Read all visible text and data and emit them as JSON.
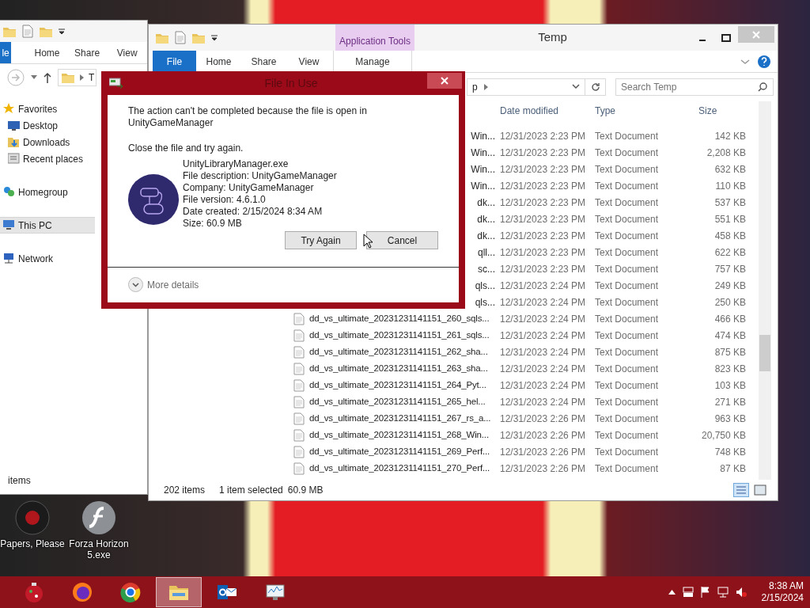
{
  "desktop": {
    "icons": [
      {
        "label": "Papers, Please",
        "kind": "game"
      },
      {
        "label": "Forza Horizon 5.exe",
        "kind": "flash"
      }
    ]
  },
  "back_window": {
    "ribbon_tabs": [
      {
        "label": "le",
        "kind": "file"
      },
      {
        "label": "Home",
        "kind": "tab"
      },
      {
        "label": "Share",
        "kind": "tab"
      },
      {
        "label": "View",
        "kind": "tab"
      }
    ],
    "address": "T",
    "nav": [
      {
        "label": "Favorites",
        "kind": "star",
        "selected": false
      },
      {
        "label": "Desktop",
        "kind": "desktop",
        "selected": false
      },
      {
        "label": "Downloads",
        "kind": "downloads",
        "selected": false
      },
      {
        "label": "Recent places",
        "kind": "recent",
        "selected": false
      },
      {
        "label": "Homegroup",
        "kind": "homegroup",
        "selected": false
      },
      {
        "label": "This PC",
        "kind": "pc",
        "selected": true
      },
      {
        "label": "Network",
        "kind": "network",
        "selected": false
      }
    ],
    "status": "items"
  },
  "window": {
    "title": "Temp",
    "context_tab": "Application Tools",
    "ribbon_tabs": [
      {
        "label": "File",
        "kind": "file"
      },
      {
        "label": "Home",
        "kind": "tab"
      },
      {
        "label": "Share",
        "kind": "tab"
      },
      {
        "label": "View",
        "kind": "tab"
      },
      {
        "label": "Manage",
        "kind": "context"
      }
    ],
    "address": "p",
    "search": {
      "placeholder": "Search Temp"
    },
    "columns": [
      "Date modified",
      "Type",
      "Size"
    ],
    "rows": [
      {
        "kind": "covered",
        "name": "Win...",
        "date": "12/31/2023 2:23 PM",
        "type": "Text Document",
        "size": "142 KB"
      },
      {
        "kind": "covered",
        "name": "Win...",
        "date": "12/31/2023 2:23 PM",
        "type": "Text Document",
        "size": "2,208 KB"
      },
      {
        "kind": "covered",
        "name": "Win...",
        "date": "12/31/2023 2:23 PM",
        "type": "Text Document",
        "size": "632 KB"
      },
      {
        "kind": "covered",
        "name": "Win...",
        "date": "12/31/2023 2:23 PM",
        "type": "Text Document",
        "size": "110 KB"
      },
      {
        "kind": "covered",
        "name": "dk...",
        "date": "12/31/2023 2:23 PM",
        "type": "Text Document",
        "size": "537 KB"
      },
      {
        "kind": "covered",
        "name": "dk...",
        "date": "12/31/2023 2:23 PM",
        "type": "Text Document",
        "size": "551 KB"
      },
      {
        "kind": "covered",
        "name": "dk...",
        "date": "12/31/2023 2:23 PM",
        "type": "Text Document",
        "size": "458 KB"
      },
      {
        "kind": "covered",
        "name": "qll...",
        "date": "12/31/2023 2:23 PM",
        "type": "Text Document",
        "size": "622 KB"
      },
      {
        "kind": "covered",
        "name": "sc...",
        "date": "12/31/2023 2:23 PM",
        "type": "Text Document",
        "size": "757 KB"
      },
      {
        "kind": "covered",
        "name": "qls...",
        "date": "12/31/2023 2:24 PM",
        "type": "Text Document",
        "size": "249 KB"
      },
      {
        "kind": "covered",
        "name": "qls...",
        "date": "12/31/2023 2:24 PM",
        "type": "Text Document",
        "size": "250 KB"
      },
      {
        "kind": "file",
        "name": "dd_vs_ultimate_20231231141151_260_sqls...",
        "date": "12/31/2023 2:24 PM",
        "type": "Text Document",
        "size": "466 KB"
      },
      {
        "kind": "file",
        "name": "dd_vs_ultimate_20231231141151_261_sqls...",
        "date": "12/31/2023 2:24 PM",
        "type": "Text Document",
        "size": "474 KB"
      },
      {
        "kind": "file",
        "name": "dd_vs_ultimate_20231231141151_262_sha...",
        "date": "12/31/2023 2:24 PM",
        "type": "Text Document",
        "size": "875 KB"
      },
      {
        "kind": "file",
        "name": "dd_vs_ultimate_20231231141151_263_sha...",
        "date": "12/31/2023 2:24 PM",
        "type": "Text Document",
        "size": "823 KB"
      },
      {
        "kind": "file",
        "name": "dd_vs_ultimate_20231231141151_264_Pyt...",
        "date": "12/31/2023 2:24 PM",
        "type": "Text Document",
        "size": "103 KB"
      },
      {
        "kind": "file",
        "name": "dd_vs_ultimate_20231231141151_265_hel...",
        "date": "12/31/2023 2:24 PM",
        "type": "Text Document",
        "size": "271 KB"
      },
      {
        "kind": "file",
        "name": "dd_vs_ultimate_20231231141151_267_rs_a...",
        "date": "12/31/2023 2:26 PM",
        "type": "Text Document",
        "size": "963 KB"
      },
      {
        "kind": "file",
        "name": "dd_vs_ultimate_20231231141151_268_Win...",
        "date": "12/31/2023 2:26 PM",
        "type": "Text Document",
        "size": "20,750 KB"
      },
      {
        "kind": "file",
        "name": "dd_vs_ultimate_20231231141151_269_Perf...",
        "date": "12/31/2023 2:26 PM",
        "type": "Text Document",
        "size": "748 KB"
      },
      {
        "kind": "file",
        "name": "dd_vs_ultimate_20231231141151_270_Perf...",
        "date": "12/31/2023 2:26 PM",
        "type": "Text Document",
        "size": "87 KB"
      }
    ],
    "status_bar": {
      "count": "202 items",
      "selection": "1 item selected",
      "selection_size": "60.9 MB"
    }
  },
  "dialog": {
    "title": "File In Use",
    "message": "The action can't be completed because the file is open in UnityGameManager",
    "instruction": "Close the file and try again.",
    "file_details": [
      "UnityLibraryManager.exe",
      "File description: UnityGameManager",
      "Company: UnityGameManager",
      "File version: 4.6.1.0",
      "Date created: 2/15/2024 8:34 AM",
      "Size: 60.9 MB"
    ],
    "buttons": [
      "Try Again",
      "Cancel"
    ],
    "more_details": "More details"
  },
  "taskbar": {
    "apps": [
      {
        "kind": "ornament",
        "active": false
      },
      {
        "kind": "fox",
        "active": false
      },
      {
        "kind": "globe",
        "active": false
      },
      {
        "kind": "folder",
        "active": true
      },
      {
        "kind": "mail",
        "active": false
      },
      {
        "kind": "monitor",
        "active": false
      }
    ],
    "clock": {
      "time": "8:38 AM",
      "date": "2/15/2024"
    }
  }
}
